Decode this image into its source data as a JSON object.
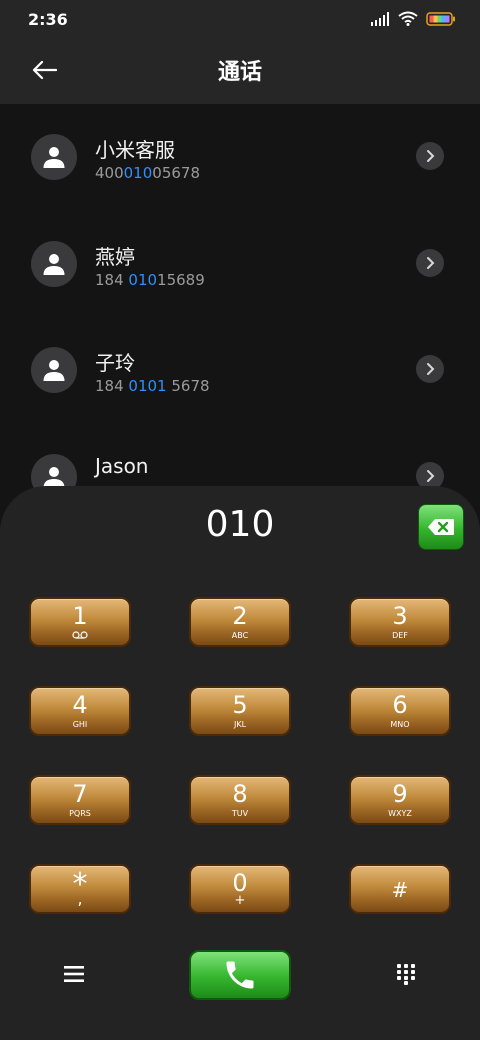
{
  "status_bar": {
    "time": "2:36",
    "icons": [
      "signal-icon",
      "wifi-icon",
      "battery-icon"
    ]
  },
  "header": {
    "title": "通话",
    "back_icon": "back-arrow-icon"
  },
  "contacts": [
    {
      "name": "小米客服",
      "number_prefix": "400",
      "number_match": "010",
      "number_suffix": "05678"
    },
    {
      "name": "燕婷",
      "number_prefix": "184 ",
      "number_match": "010",
      "number_suffix": "15689"
    },
    {
      "name": "子玲",
      "number_prefix": "184 ",
      "number_match": "0101",
      "number_suffix": " 5678"
    },
    {
      "name": "Jason",
      "number_prefix": "",
      "number_match": "",
      "number_suffix": ""
    }
  ],
  "dialpad": {
    "number": "010",
    "keys": [
      {
        "digit": "1",
        "letters": ""
      },
      {
        "digit": "2",
        "letters": "ABC"
      },
      {
        "digit": "3",
        "letters": "DEF"
      },
      {
        "digit": "4",
        "letters": "GHI"
      },
      {
        "digit": "5",
        "letters": "JKL"
      },
      {
        "digit": "6",
        "letters": "MNO"
      },
      {
        "digit": "7",
        "letters": "PQRS"
      },
      {
        "digit": "8",
        "letters": "TUV"
      },
      {
        "digit": "9",
        "letters": "WXYZ"
      },
      {
        "digit": "*",
        "letters": ","
      },
      {
        "digit": "0",
        "letters": "+"
      },
      {
        "digit": "#",
        "letters": ""
      }
    ]
  },
  "colors": {
    "accent_blue": "#2f8fff",
    "key_gold": "#c08a3c",
    "call_green": "#35b52e",
    "background": "#141414",
    "panel": "#232323"
  }
}
